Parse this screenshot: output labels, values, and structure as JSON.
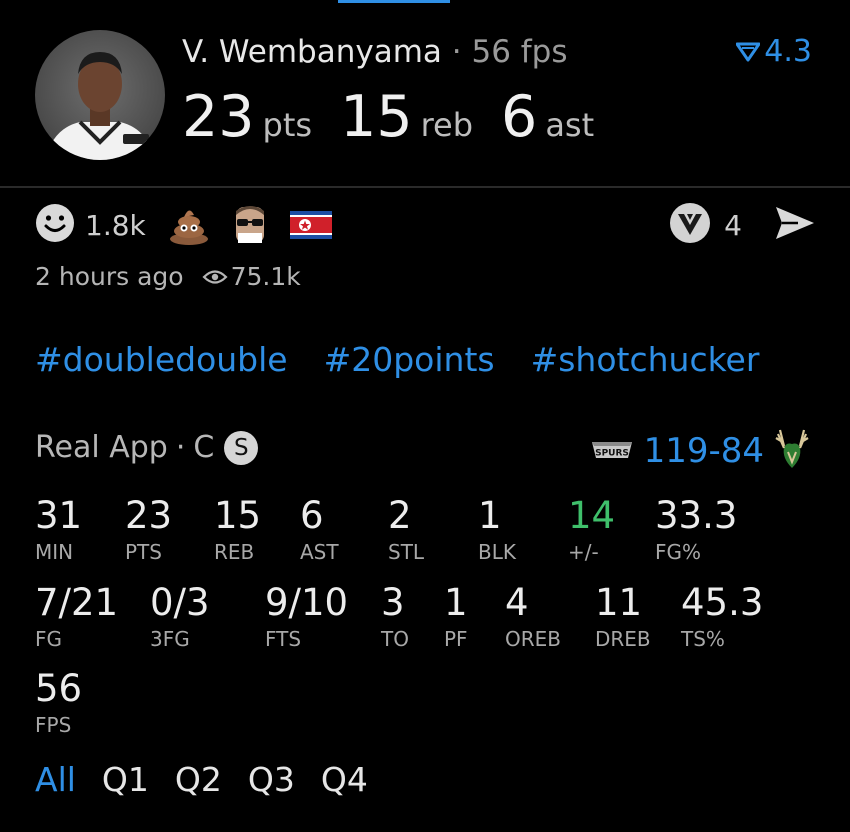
{
  "player": {
    "name": "V. Wembanyama",
    "separator": "·",
    "fps_label": "56 fps",
    "rating": "4.3",
    "headline": [
      {
        "value": "23",
        "unit": "pts"
      },
      {
        "value": "15",
        "unit": "reb"
      },
      {
        "value": "6",
        "unit": "ast"
      }
    ]
  },
  "reactions": {
    "smile_count": "1.8k",
    "share_count": "4",
    "time_ago": "2 hours ago",
    "views": "75.1k"
  },
  "hashtags": [
    "#doubledouble",
    "#20points",
    "#shotchucker"
  ],
  "game": {
    "source": "Real App",
    "separator": "·",
    "position": "C",
    "badge": "S",
    "score": "119-84",
    "team_logo_text": "SPURS"
  },
  "stats_row1": [
    {
      "value": "31",
      "label": "MIN"
    },
    {
      "value": "23",
      "label": "PTS"
    },
    {
      "value": "15",
      "label": "REB"
    },
    {
      "value": "6",
      "label": "AST"
    },
    {
      "value": "2",
      "label": "STL"
    },
    {
      "value": "1",
      "label": "BLK"
    },
    {
      "value": "14",
      "label": "+/-"
    },
    {
      "value": "33.3",
      "label": "FG%"
    }
  ],
  "stats_row2": [
    {
      "value": "7/21",
      "label": "FG"
    },
    {
      "value": "0/3",
      "label": "3FG"
    },
    {
      "value": "9/10",
      "label": "FTS"
    },
    {
      "value": "3",
      "label": "TO"
    },
    {
      "value": "1",
      "label": "PF"
    },
    {
      "value": "4",
      "label": "OREB"
    },
    {
      "value": "11",
      "label": "DREB"
    },
    {
      "value": "45.3",
      "label": "TS%"
    }
  ],
  "stats_row3": [
    {
      "value": "56",
      "label": "FPS"
    }
  ],
  "quarters": [
    "All",
    "Q1",
    "Q2",
    "Q3",
    "Q4"
  ],
  "colors": {
    "accent": "#2f8fe5",
    "positive": "#3fbf6b",
    "background": "#000000"
  }
}
